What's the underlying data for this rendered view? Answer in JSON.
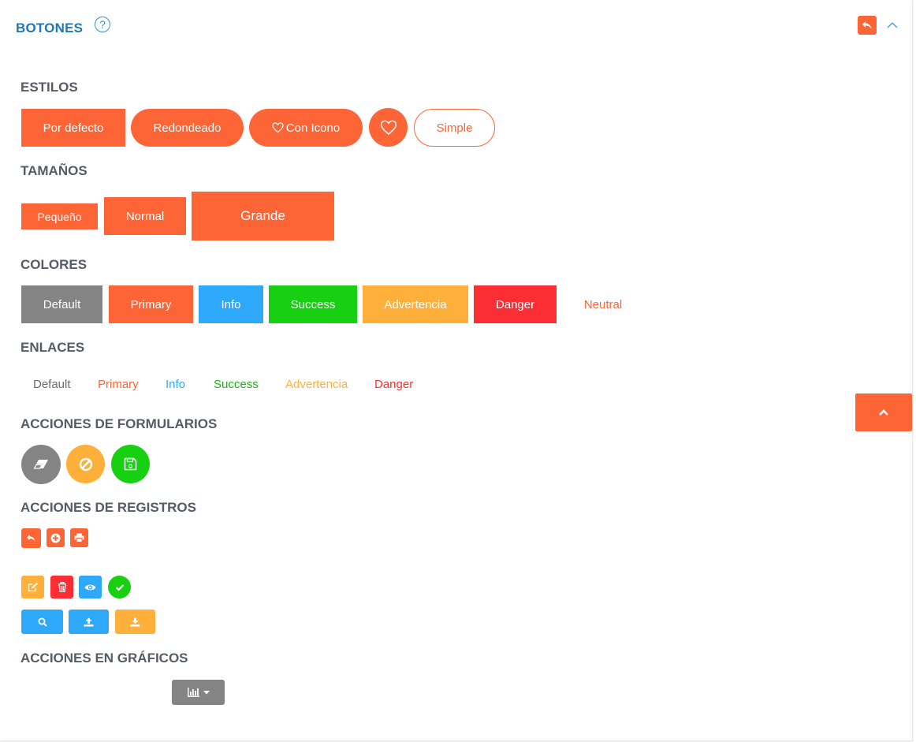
{
  "header": {
    "title": "BOTONES",
    "help_glyph": "?"
  },
  "sections": {
    "estilos": "ESTILOS",
    "tamanos": "TAMAÑOS",
    "colores": "COLORES",
    "enlaces": "ENLACES",
    "acciones_formularios": "ACCIONES DE FORMULARIOS",
    "acciones_registros": "ACCIONES DE REGISTROS",
    "acciones_graficos": "ACCIONES EN GRÁFICOS"
  },
  "estilos": {
    "por_defecto": "Por defecto",
    "redondeado": "Redondeado",
    "con_icono": "Con Icono",
    "simple": "Simple"
  },
  "tamanos": {
    "pequeno": "Pequeño",
    "normal": "Normal",
    "grande": "Grande"
  },
  "colores": {
    "default": "Default",
    "primary": "Primary",
    "info": "Info",
    "success": "Success",
    "advertencia": "Advertencia",
    "danger": "Danger",
    "neutral": "Neutral"
  },
  "enlaces": {
    "default": "Default",
    "primary": "Primary",
    "info": "Info",
    "success": "Success",
    "advertencia": "Advertencia",
    "danger": "Danger"
  },
  "palette": {
    "primary": "#fd6536",
    "default": "#848484",
    "info": "#2ea8f8",
    "success": "#16d011",
    "warning": "#ffb03a",
    "danger": "#fd2e33",
    "title_blue": "#1f78b4"
  },
  "icons": {
    "header_back": "reply-icon",
    "header_collapse": "chevron-up-icon",
    "con_icono": "heart-icon",
    "icon_only": "heart-icon",
    "form_clear": "eraser-icon",
    "form_cancel": "ban-icon",
    "form_save": "save-icon",
    "rec_back": "reply-icon",
    "rec_add": "plus-circle-icon",
    "rec_print": "print-icon",
    "rec_edit": "edit-icon",
    "rec_delete": "trash-icon",
    "rec_view": "eye-icon",
    "rec_approve": "check-icon",
    "rec_search": "search-icon",
    "rec_upload": "upload-icon",
    "rec_download": "download-icon",
    "chart_menu": "bar-chart-icon",
    "scroll_top": "chevron-up-icon"
  }
}
